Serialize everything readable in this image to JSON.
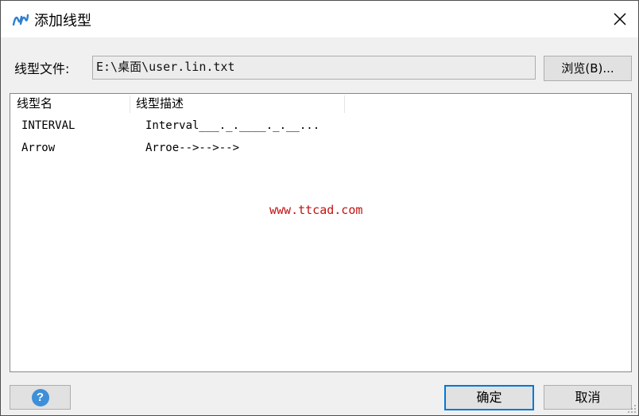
{
  "window": {
    "title": "添加线型",
    "close_icon": "close-icon",
    "app_icon": "linetype-app-icon"
  },
  "file": {
    "label": "线型文件:",
    "value": "E:\\桌面\\user.lin.txt",
    "browse_label": "浏览(B)..."
  },
  "list": {
    "columns": [
      "线型名",
      "线型描述"
    ],
    "rows": [
      {
        "name": "INTERVAL",
        "description": "Interval___._.____._.__..."
      },
      {
        "name": "Arrow",
        "description": "Arroe-->-->-->"
      }
    ]
  },
  "watermark": "www.ttcad.com",
  "buttons": {
    "help_icon": "help-icon",
    "ok_label": "确定",
    "cancel_label": "取消"
  },
  "colors": {
    "accent": "#0078d7",
    "watermark": "#c21212",
    "help": "#3d8fd9"
  }
}
